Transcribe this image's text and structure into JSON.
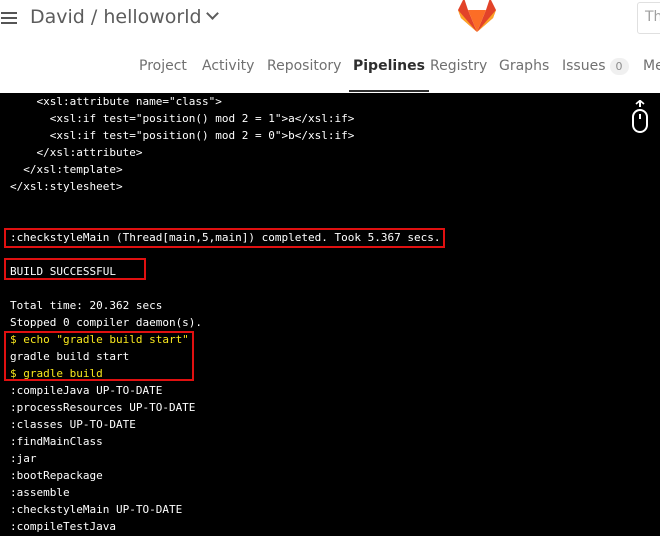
{
  "header": {
    "project_path": "David / helloworld",
    "search_placeholder": "Th"
  },
  "nav": {
    "items": [
      {
        "label": "Project"
      },
      {
        "label": "Activity"
      },
      {
        "label": "Repository"
      },
      {
        "label": "Pipelines"
      },
      {
        "label": "Registry"
      },
      {
        "label": "Graphs"
      },
      {
        "label": "Issues"
      },
      {
        "label": "Me"
      }
    ],
    "issues_count": "0",
    "active": "Pipelines"
  },
  "terminal": {
    "lines": [
      "    <xsl:attribute name=\"class\">",
      "      <xsl:if test=\"position() mod 2 = 1\">a</xsl:if>",
      "      <xsl:if test=\"position() mod 2 = 0\">b</xsl:if>",
      "    </xsl:attribute>",
      "  </xsl:template>",
      "</xsl:stylesheet>",
      "",
      "",
      ":checkstyleMain (Thread[main,5,main]) completed. Took 5.367 secs.",
      "",
      "BUILD SUCCESSFUL",
      "",
      "Total time: 20.362 secs",
      "Stopped 0 compiler daemon(s).",
      "$ echo \"gradle build start\"",
      "gradle build start",
      "$ gradle build",
      ":compileJava UP-TO-DATE",
      ":processResources UP-TO-DATE",
      ":classes UP-TO-DATE",
      ":findMainClass",
      ":jar",
      ":bootRepackage",
      ":assemble",
      ":checkstyleMain UP-TO-DATE",
      ":compileTestJava"
    ]
  },
  "colors": {
    "terminal_bg": "#000000",
    "terminal_text": "#ffffff",
    "command_text": "#f8e71c",
    "highlight_border": "#e01010",
    "logo_orange": "#fc6d26"
  },
  "icons": [
    "hamburger-icon",
    "chevron-down-icon",
    "gitlab-logo-icon",
    "scroll-to-bottom-icon"
  ]
}
